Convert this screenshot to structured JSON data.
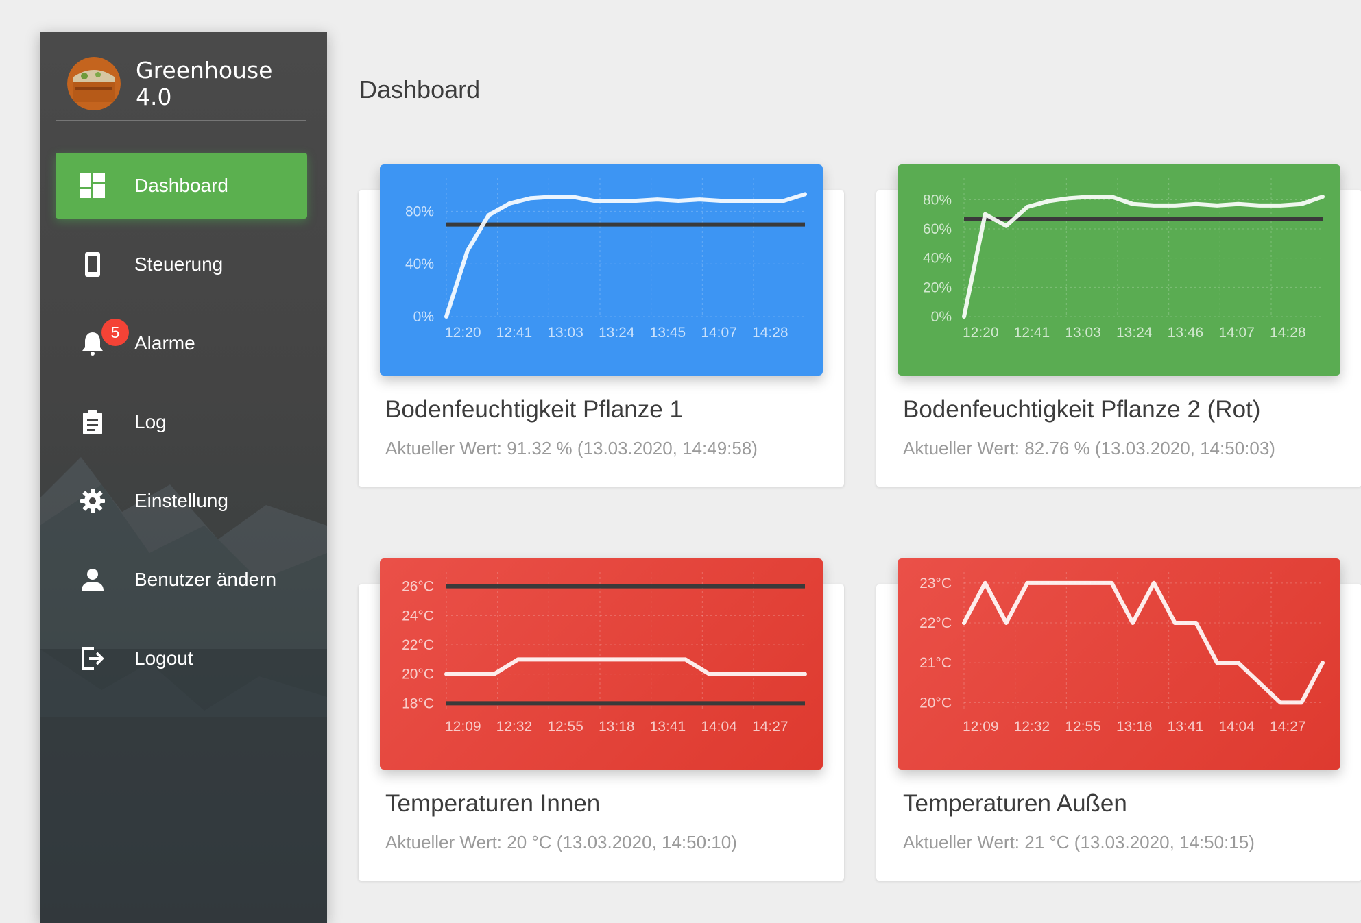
{
  "app": {
    "name": "Greenhouse 4.0"
  },
  "page": {
    "title": "Dashboard"
  },
  "sidebar": {
    "items": [
      {
        "label": "Dashboard",
        "icon": "dashboard-icon",
        "active": true
      },
      {
        "label": "Steuerung",
        "icon": "phone-icon"
      },
      {
        "label": "Alarme",
        "icon": "bell-icon",
        "badge": "5"
      },
      {
        "label": "Log",
        "icon": "clipboard-icon"
      },
      {
        "label": "Einstellung",
        "icon": "gear-icon"
      },
      {
        "label": "Benutzer ändern",
        "icon": "user-icon"
      },
      {
        "label": "Logout",
        "icon": "logout-icon"
      }
    ]
  },
  "colors": {
    "blue": "#3d95f3",
    "green": "#5aac52",
    "red": "#e8463d",
    "sidebar_active": "#5bb04f"
  },
  "cards": [
    {
      "title": "Bodenfeuchtigkeit Pflanze 1",
      "subtitle": "Aktueller Wert: 91.32 % (13.03.2020, 14:49:58)",
      "color": "#3d95f3"
    },
    {
      "title": "Bodenfeuchtigkeit Pflanze 2 (Rot)",
      "subtitle": "Aktueller Wert: 82.76 % (13.03.2020, 14:50:03)",
      "color": "#5aac52"
    },
    {
      "title": "Temperaturen Innen",
      "subtitle": "Aktueller Wert: 20 °C (13.03.2020, 14:50:10)",
      "color": "#e8463d"
    },
    {
      "title": "Temperaturen Außen",
      "subtitle": "Aktueller Wert: 21 °C (13.03.2020, 14:50:15)",
      "color": "#e8463d"
    }
  ],
  "chart_data": [
    {
      "type": "line",
      "title": "",
      "x_ticks": [
        "12:20",
        "12:41",
        "13:03",
        "13:24",
        "13:45",
        "14:07",
        "14:28"
      ],
      "y_ticks": [
        "0%",
        "40%",
        "80%"
      ],
      "ylim": [
        0,
        100
      ],
      "grid": true,
      "series": [
        {
          "values": [
            0,
            50,
            77,
            86,
            90,
            91,
            91,
            88,
            88,
            88,
            89,
            88,
            89,
            88,
            88,
            88,
            88,
            93
          ]
        }
      ],
      "threshold": 70
    },
    {
      "type": "line",
      "title": "",
      "x_ticks": [
        "12:20",
        "12:41",
        "13:03",
        "13:24",
        "13:46",
        "14:07",
        "14:28"
      ],
      "y_ticks": [
        "0%",
        "20%",
        "40%",
        "60%",
        "80%"
      ],
      "ylim": [
        0,
        90
      ],
      "grid": true,
      "series": [
        {
          "values": [
            0,
            70,
            62,
            75,
            79,
            81,
            82,
            82,
            77,
            76,
            76,
            77,
            76,
            77,
            76,
            76,
            77,
            82
          ]
        }
      ],
      "threshold": 67
    },
    {
      "type": "line",
      "title": "",
      "x_ticks": [
        "12:09",
        "12:32",
        "12:55",
        "13:18",
        "13:41",
        "14:04",
        "14:27"
      ],
      "y_ticks": [
        "18°C",
        "20°C",
        "22°C",
        "24°C",
        "26°C"
      ],
      "ylim": [
        17.5,
        26.5
      ],
      "grid": true,
      "series": [
        {
          "values": [
            20,
            20,
            20,
            21,
            21,
            21,
            21,
            21,
            21,
            21,
            21,
            20,
            20,
            20,
            20,
            20
          ]
        }
      ],
      "thresholds": [
        18,
        26
      ]
    },
    {
      "type": "line",
      "title": "",
      "x_ticks": [
        "12:09",
        "12:32",
        "12:55",
        "13:18",
        "13:41",
        "14:04",
        "14:27"
      ],
      "y_ticks": [
        "20°C",
        "21°C",
        "22°C",
        "23°C"
      ],
      "ylim": [
        19.8,
        23.1
      ],
      "grid": true,
      "series": [
        {
          "values": [
            22,
            23,
            22,
            23,
            23,
            23,
            23,
            23,
            22,
            23,
            22,
            22,
            21,
            21,
            20.5,
            20,
            20,
            21
          ]
        }
      ]
    }
  ]
}
